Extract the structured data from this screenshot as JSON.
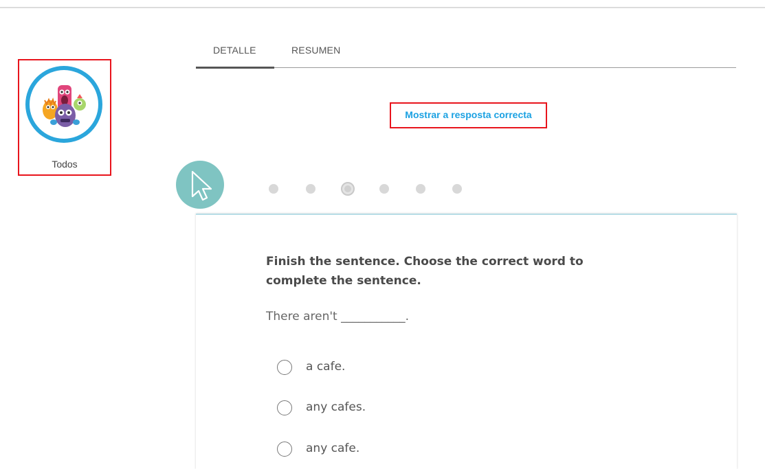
{
  "filter": {
    "label": "Todos",
    "avatar_icon": "monsters-avatar-icon"
  },
  "tabs": [
    {
      "label": "DETALLE",
      "active": true
    },
    {
      "label": "RESUMEN",
      "active": false
    }
  ],
  "show_answer": {
    "label": "Mostrar a resposta correcta"
  },
  "pagination": {
    "total": 6,
    "current": 3
  },
  "question": {
    "title": "Finish the sentence. Choose the correct word to complete the sentence.",
    "sentence": "There aren't ___________."
  },
  "options": [
    {
      "label": "a cafe."
    },
    {
      "label": "any cafes."
    },
    {
      "label": "any cafe."
    }
  ],
  "colors": {
    "accent": "#1ba1e2",
    "highlight": "#e8141c",
    "avatar_ring": "#2ba6dc",
    "cursor_circle": "#7fc4c2"
  }
}
